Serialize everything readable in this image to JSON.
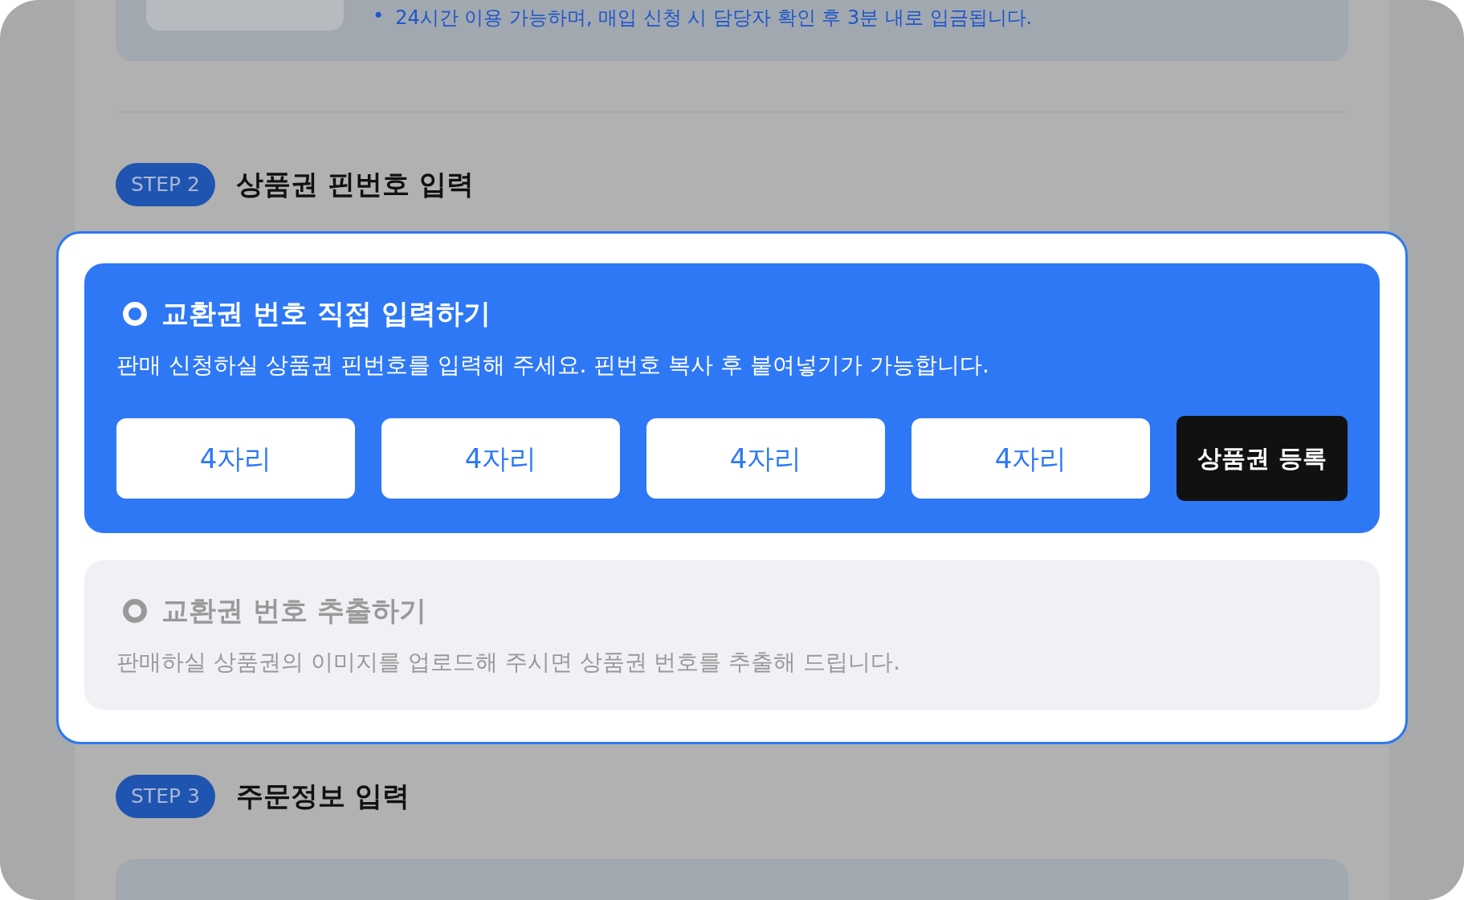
{
  "notice": {
    "bullet": "•",
    "text": "24시간 이용 가능하며, 매입 신청 시 담당자 확인 후 3분 내로 입금됩니다."
  },
  "steps": [
    {
      "badge": "STEP 2",
      "title": "상품권 핀번호 입력"
    },
    {
      "badge": "STEP 3",
      "title": "주문정보 입력"
    }
  ],
  "options": [
    {
      "title": "교환권 번호 직접 입력하기",
      "description": "판매 신청하실 상품권 핀번호를 입력해 주세요. 핀번호 복사 후 붙여넣기가 가능합니다.",
      "selected": true
    },
    {
      "title": "교환권 번호 추출하기",
      "description": "판매하실 상품권의 이미지를 업로드해 주시면 상품권 번호를 추출해 드립니다.",
      "selected": false
    }
  ],
  "pin_fields": [
    {
      "placeholder": "4자리"
    },
    {
      "placeholder": "4자리"
    },
    {
      "placeholder": "4자리"
    },
    {
      "placeholder": "4자리"
    }
  ],
  "register_button": "상품권 등록"
}
